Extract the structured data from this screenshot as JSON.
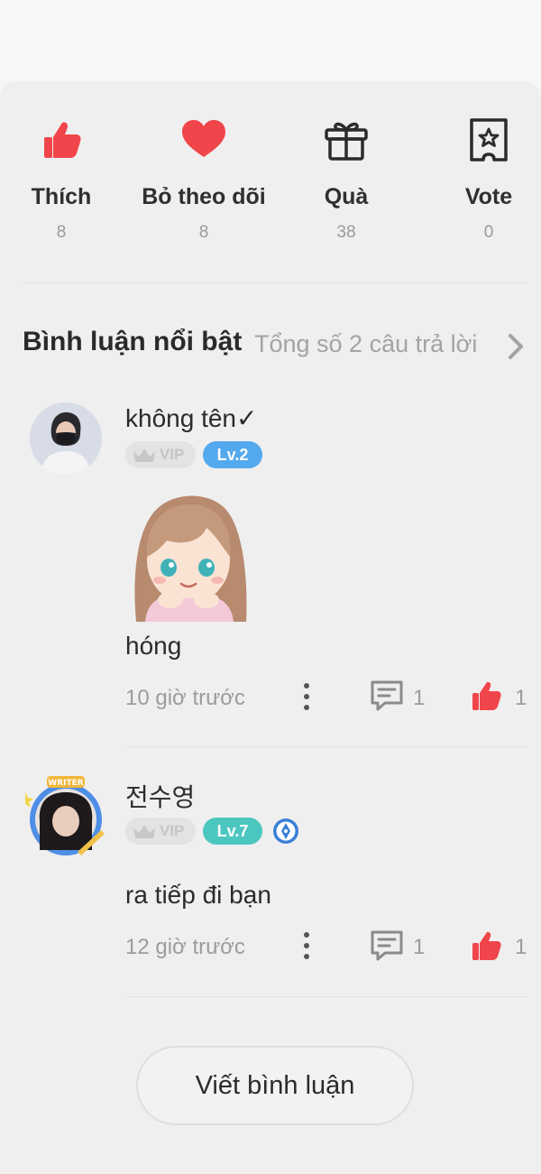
{
  "stats": [
    {
      "label": "Thích",
      "count": "8",
      "icon": "thumbs-up-icon"
    },
    {
      "label": "Bỏ theo dõi",
      "count": "8",
      "icon": "heart-icon"
    },
    {
      "label": "Quà",
      "count": "38",
      "icon": "gift-icon"
    },
    {
      "label": "Vote",
      "count": "0",
      "icon": "ticket-star-icon"
    }
  ],
  "section": {
    "title": "Bình luận nổi bật",
    "total": "Tổng số 2 câu trả lời"
  },
  "comments": [
    {
      "username": "không tên✓",
      "vip": "VIP",
      "level": "Lv.2",
      "content": "hóng",
      "time": "10 giờ trước",
      "replies": "1",
      "likes": "1"
    },
    {
      "username": "전수영",
      "vip": "VIP",
      "level": "Lv.7",
      "content": "ra tiếp đi bạn",
      "time": "12 giờ trước",
      "replies": "1",
      "likes": "1"
    }
  ],
  "write_button": "Viết bình luận",
  "colors": {
    "accent": "#f0454a",
    "lv2": "#53a9ee",
    "lv7": "#4cc7c0"
  }
}
